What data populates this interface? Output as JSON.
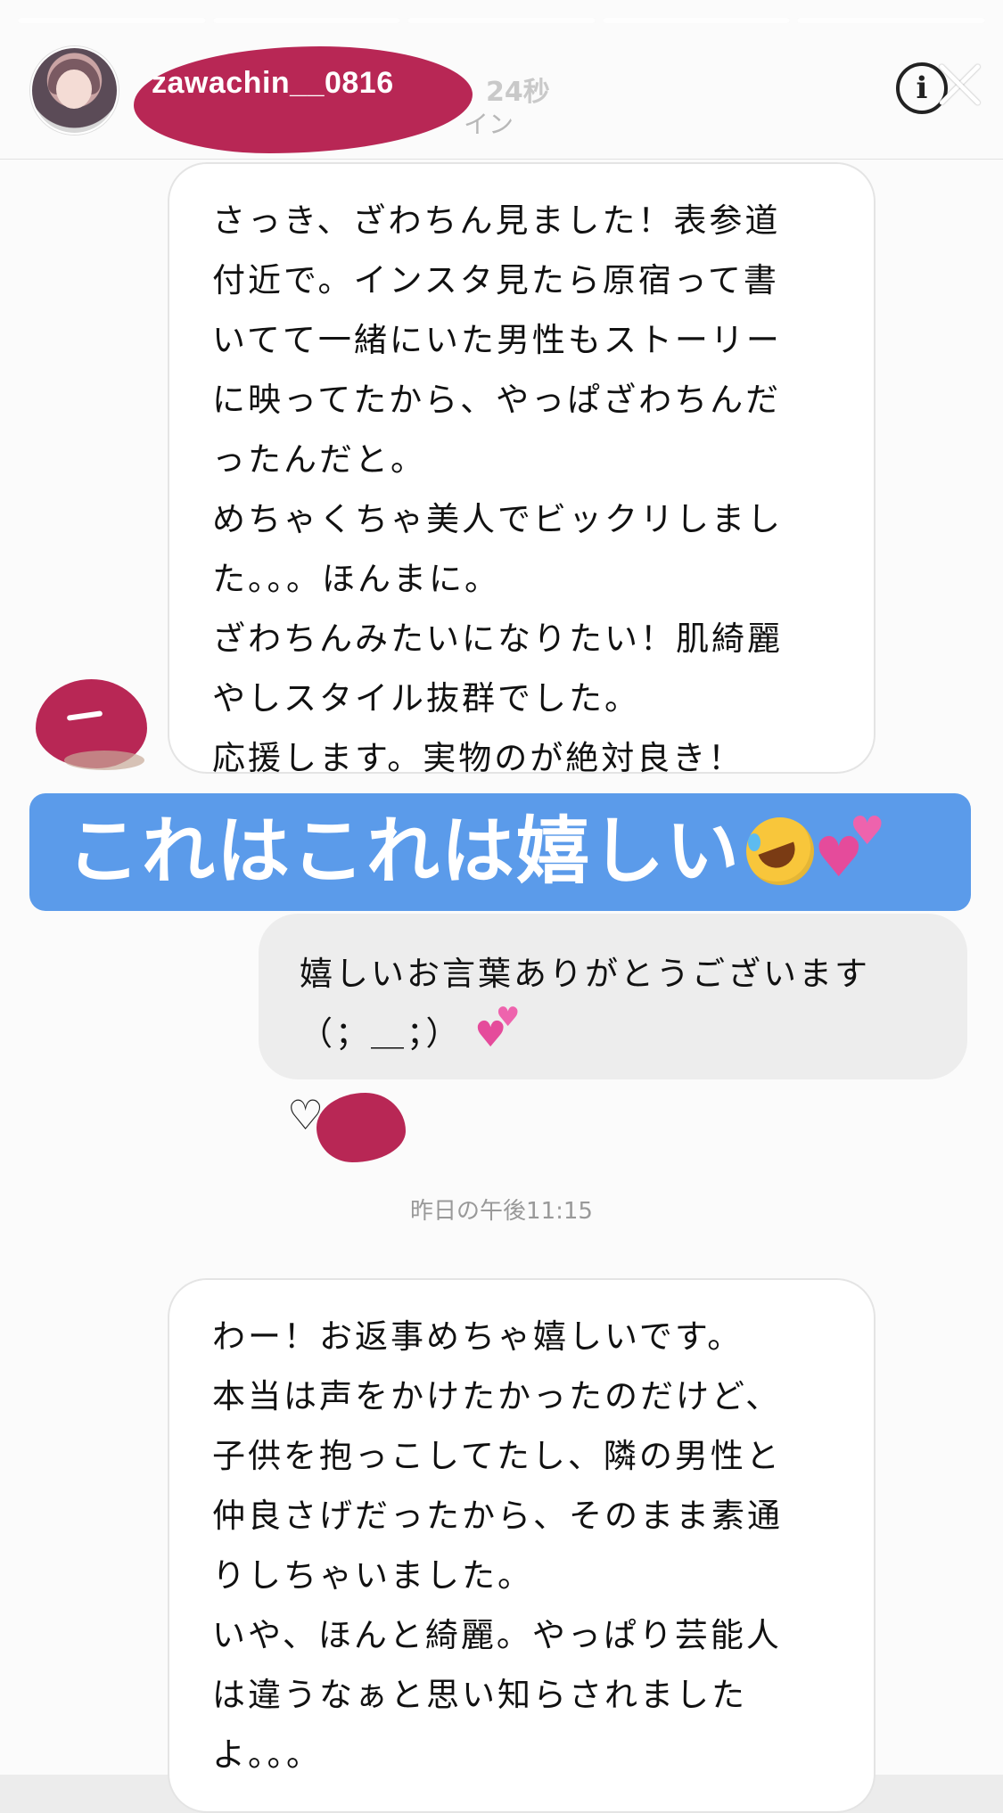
{
  "story": {
    "progress_segments": [
      1,
      1,
      1,
      1,
      1
    ],
    "username": "zawachin__0816",
    "time_ago": "24秒",
    "faded_label": "イン"
  },
  "messages": {
    "received_1": "さっき、ざわちん見ました！表参道\n付近で。インスタ見たら原宿って書\nいてて一緒にいた男性もストーリー\nに映ってたから、やっぱざわちんだ\nったんだと。\nめちゃくちゃ美人でビックリしまし\nた。。。ほんまに。\nざわちんみたいになりたい！肌綺麗\nやしスタイル抜群でした。\n応援します。実物のが絶対良き！",
    "caption": "これはこれは嬉しい",
    "sent_1": "嬉しいお言葉ありがとうございます\n（；＿；）",
    "timestamp": "昨日の午後11:15",
    "received_2": "わー！お返事めちゃ嬉しいです。\n本当は声をかけたかったのだけど、\n子供を抱っこしてたし、隣の男性と\n仲良さげだったから、そのまま素通\nりしちゃいました。\nいや、ほんと綺麗。やっぱり芸能人\nは違うなぁと思い知らされました\nよ。。。"
  },
  "icons": {
    "info": "info-icon",
    "close": "close-icon",
    "heart": "heart-outline-icon",
    "emoji_laugh": "rolling-laughing-emoji",
    "emoji_hearts": "two-hearts-emoji"
  },
  "colors": {
    "caption_bg": "#5b9bea",
    "redaction": "#b41b4c",
    "hearts": "#e54b9b"
  }
}
